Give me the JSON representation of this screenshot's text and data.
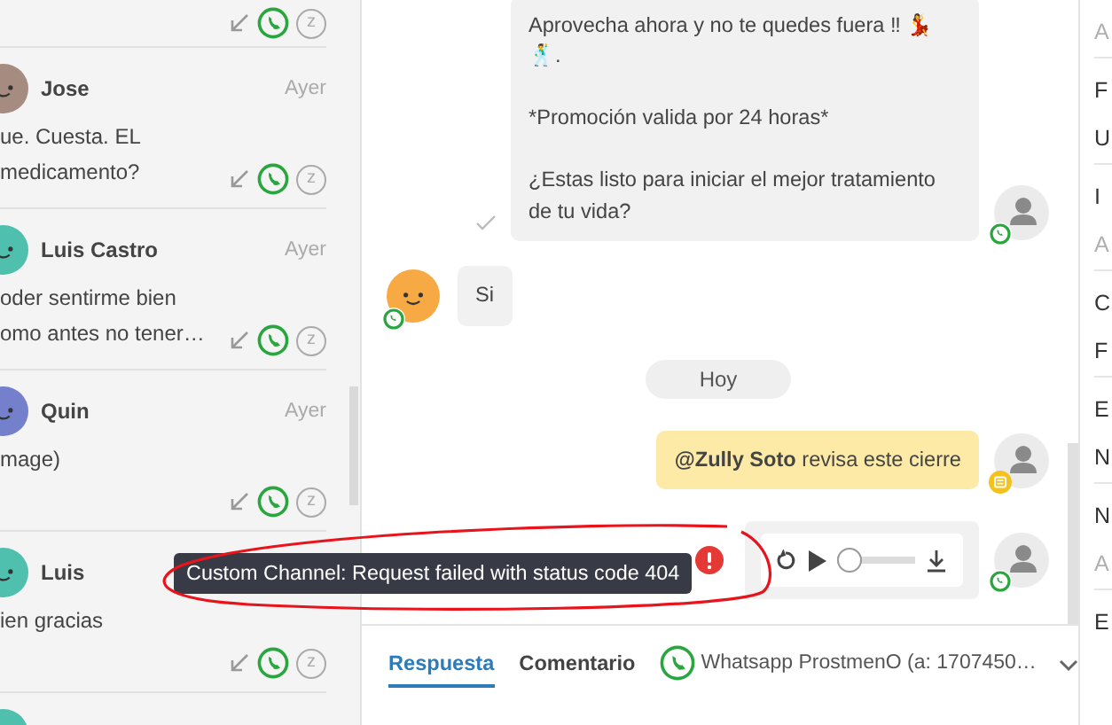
{
  "contacts": [
    {
      "badge": "z"
    },
    {
      "name": "Jose",
      "time": "Ayer",
      "preview": "ue. Cuesta. EL\nmedicamento?",
      "color": "#a58b80",
      "badge": "z"
    },
    {
      "name": "Luis Castro",
      "time": "Ayer",
      "preview": "oder sentirme bien\nomo antes no tener…",
      "color": "#4fbfae",
      "badge": "z"
    },
    {
      "name": "Quin",
      "time": "Ayer",
      "preview": "mage)",
      "color": "#7480cc",
      "badge": "z"
    },
    {
      "name": "Luis",
      "preview": "ien gracias",
      "color": "#4fbfae",
      "badge": "z"
    },
    {
      "color": "#4fbfae"
    }
  ],
  "chat": {
    "messages": [
      {
        "kind": "text",
        "incoming": false,
        "text": "Aprovecha ahora y no te quedes fuera ‼ 💃🕺.\n\n*Promoción valida por 24 horas*\n\n¿Estas listo para iniciar el mejor tratamiento de tu vida?"
      },
      {
        "kind": "text",
        "incoming": true,
        "text": "Si",
        "color": "#f7a944"
      },
      {
        "kind": "date",
        "text": "Hoy"
      },
      {
        "kind": "note",
        "incoming": false,
        "text": "**@Zully Soto** revisa este cierre"
      },
      {
        "kind": "audio",
        "incoming": false,
        "level": 0,
        "error": "Custom Channel: Request failed with status code 404"
      }
    ]
  },
  "composer": {
    "tabs": [
      {
        "label": "Respuesta",
        "selected": true
      },
      {
        "label": "Comentario",
        "selected": false
      }
    ],
    "channel": "Whatsapp ProstmenO (a: 1707450…"
  },
  "side_panel": {
    "groups": [
      [
        {
          "text": "A",
          "muted": true
        }
      ],
      [
        {
          "text": "F",
          "muted": false
        },
        {
          "text": "U",
          "muted": false
        }
      ],
      [
        {
          "text": "I",
          "muted": false
        },
        {
          "text": "A",
          "muted": true
        }
      ],
      [
        {
          "text": "C",
          "muted": false
        },
        {
          "text": "F",
          "muted": false
        }
      ],
      [
        {
          "text": "E",
          "muted": false
        },
        {
          "text": "N",
          "muted": false
        }
      ],
      [
        {
          "text": "N",
          "muted": false
        },
        {
          "text": "A",
          "muted": true
        }
      ],
      [
        {
          "text": "E",
          "muted": false
        }
      ]
    ]
  }
}
